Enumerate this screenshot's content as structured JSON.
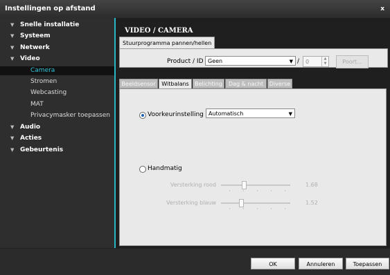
{
  "window": {
    "title": "Instellingen op afstand",
    "close_glyph": "x"
  },
  "sidebar": {
    "items": [
      {
        "label": "Snelle installatie",
        "level": "top"
      },
      {
        "label": "Systeem",
        "level": "top"
      },
      {
        "label": "Netwerk",
        "level": "top"
      },
      {
        "label": "Video",
        "level": "top"
      },
      {
        "label": "Camera",
        "level": "sub",
        "active": true
      },
      {
        "label": "Stromen",
        "level": "sub"
      },
      {
        "label": "Webcasting",
        "level": "sub"
      },
      {
        "label": "MAT",
        "level": "sub"
      },
      {
        "label": "Privacymasker toepassen",
        "level": "sub"
      },
      {
        "label": "Audio",
        "level": "top"
      },
      {
        "label": "Acties",
        "level": "top"
      },
      {
        "label": "Gebeurtenis",
        "level": "top"
      }
    ]
  },
  "main": {
    "heading": "VIDEO / CAMERA",
    "driver_tab": "Stuurprogramma pannen/hellen",
    "product_label": "Product / ID",
    "product_value": "Geen",
    "slash": "/",
    "id_value": "0",
    "port_button": "Poort...",
    "tabs": [
      {
        "label": "Beeldsensor",
        "active": false
      },
      {
        "label": "Witbalans",
        "active": true
      },
      {
        "label": "Belichting",
        "active": false
      },
      {
        "label": "Dag & nacht",
        "active": false
      },
      {
        "label": "Diverse",
        "active": false
      }
    ],
    "preset": {
      "label": "Voorkeurinstelling",
      "value": "Automatisch",
      "selected": true
    },
    "manual": {
      "label": "Handmatig",
      "selected": false
    },
    "sliders": [
      {
        "label": "Versterking rood",
        "value": "1.68",
        "position": 0.35
      },
      {
        "label": "Versterking blauw",
        "value": "1.52",
        "position": 0.31
      }
    ]
  },
  "footer": {
    "ok": "OK",
    "cancel": "Annuleren",
    "apply": "Toepassen"
  },
  "colors": {
    "accent": "#29b6c9",
    "active_text": "#2fc3d6"
  }
}
